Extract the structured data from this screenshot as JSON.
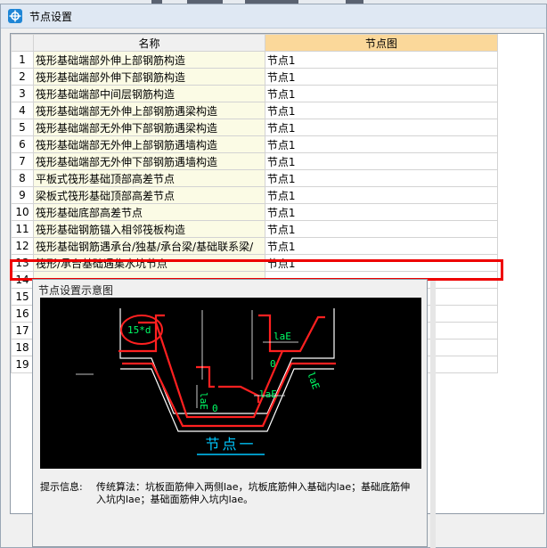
{
  "window": {
    "title": "节点设置"
  },
  "grid": {
    "columns": [
      "名称",
      "节点图"
    ],
    "rows": [
      {
        "no": "1",
        "name": "筏形基础端部外伸上部钢筋构造",
        "node": "节点1"
      },
      {
        "no": "2",
        "name": "筏形基础端部外伸下部钢筋构造",
        "node": "节点1"
      },
      {
        "no": "3",
        "name": "筏形基础端部中间层钢筋构造",
        "node": "节点1"
      },
      {
        "no": "4",
        "name": "筏形基础端部无外伸上部钢筋遇梁构造",
        "node": "节点1"
      },
      {
        "no": "5",
        "name": "筏形基础端部无外伸下部钢筋遇梁构造",
        "node": "节点1"
      },
      {
        "no": "6",
        "name": "筏形基础端部无外伸上部钢筋遇墙构造",
        "node": "节点1"
      },
      {
        "no": "7",
        "name": "筏形基础端部无外伸下部钢筋遇墙构造",
        "node": "节点1"
      },
      {
        "no": "8",
        "name": "平板式筏形基础顶部高差节点",
        "node": "节点1"
      },
      {
        "no": "9",
        "name": "梁板式筏形基础顶部高差节点",
        "node": "节点1"
      },
      {
        "no": "10",
        "name": "筏形基础底部高差节点",
        "node": "节点1"
      },
      {
        "no": "11",
        "name": "筏形基础钢筋锚入相邻筏板构造",
        "node": "节点1"
      },
      {
        "no": "12",
        "name": "筏形基础钢筋遇承台/独基/承台梁/基础联系梁/",
        "node": "节点1"
      },
      {
        "no": "13",
        "name": "筏形/承台基础遇集水坑节点",
        "node": "节点1"
      },
      {
        "no": "14",
        "name": "",
        "node": ""
      },
      {
        "no": "15",
        "name": "",
        "node": ""
      },
      {
        "no": "16",
        "name": "",
        "node": ""
      },
      {
        "no": "17",
        "name": "",
        "node": ""
      },
      {
        "no": "18",
        "name": "",
        "node": ""
      },
      {
        "no": "19",
        "name": "",
        "node": ""
      }
    ]
  },
  "preview": {
    "title": "节点设置示意图",
    "labels": {
      "dim15d": "15*d",
      "laE1": "laE",
      "laE2": "laE",
      "laE3": "laE",
      "laE4": "laE",
      "zero1": "0",
      "zero2": "0"
    },
    "caption": "节点一",
    "hint_label": "提示信息:",
    "hint_text": "传统算法：坑板面筋伸入两侧lae，坑板底筋伸入基础内lae；基础底筋伸入坑内lae；基础面筋伸入坑内lae。"
  },
  "colors": {
    "selection": "#ee0000",
    "rebar": "#ff2020",
    "concrete": "#ffffff",
    "dimension": "#00ff66",
    "caption": "#00c8ff",
    "header_highlight": "#fbd89a",
    "name_cell": "#fbfbe5"
  }
}
